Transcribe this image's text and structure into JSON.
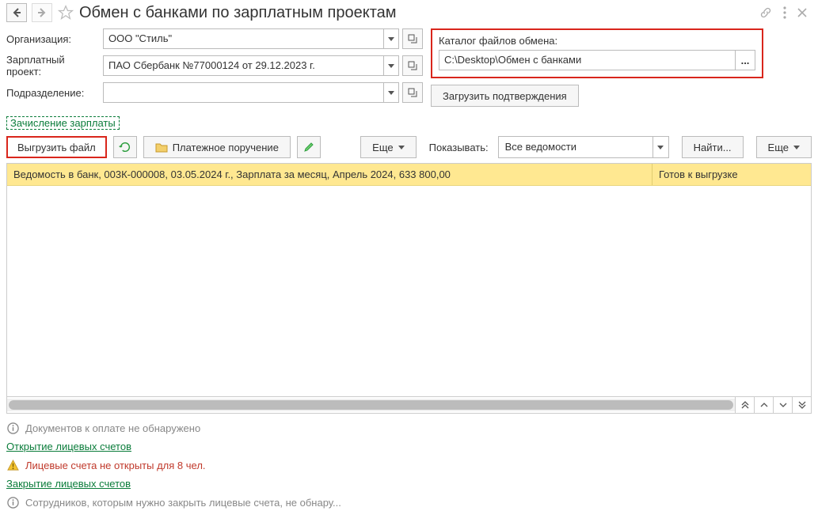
{
  "header": {
    "title": "Обмен с банками по зарплатным проектам"
  },
  "form": {
    "org_label": "Организация:",
    "org_value": "ООО \"Стиль\"",
    "project_label": "Зарплатный проект:",
    "project_value": "ПАО Сбербанк №77000124 от 29.12.2023 г.",
    "subdivision_label": "Подразделение:",
    "subdivision_value": ""
  },
  "catalog": {
    "label": "Каталог файлов обмена:",
    "path": "C:\\Desktop\\Обмен с банками",
    "load_button": "Загрузить подтверждения"
  },
  "tab": {
    "label": "Зачисление зарплаты"
  },
  "toolbar": {
    "export_file": "Выгрузить файл",
    "payment_order": "Платежное поручение",
    "more": "Еще",
    "show_label": "Показывать:",
    "show_value": "Все ведомости",
    "find": "Найти...",
    "more2": "Еще"
  },
  "grid": {
    "rows": [
      {
        "desc": "Ведомость в банк, 003К-000008, 03.05.2024 г., Зарплата за месяц, Апрель 2024, 633 800,00",
        "status": "Готов к выгрузке"
      }
    ]
  },
  "info": {
    "no_docs": "Документов к оплате не обнаружено",
    "open_accounts_link": "Открытие лицевых счетов",
    "accounts_warning": "Лицевые счета не открыты для 8 чел.",
    "close_accounts_link": "Закрытие лицевых счетов",
    "close_info": "Сотрудников, которым нужно закрыть лицевые счета, не обнару..."
  }
}
